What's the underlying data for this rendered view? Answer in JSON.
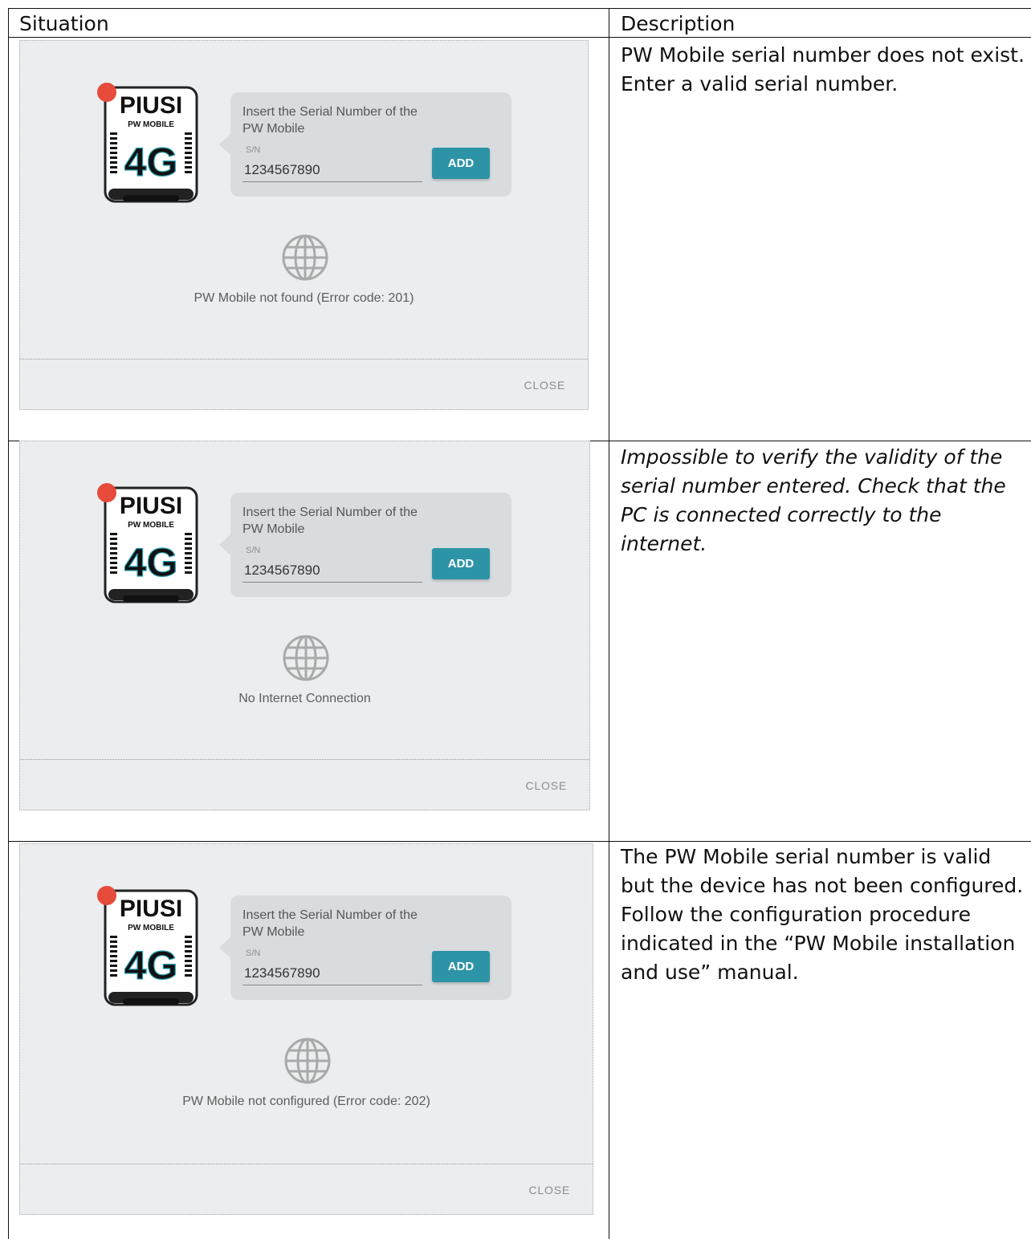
{
  "table": {
    "header_situation": "Situation",
    "header_description": "Description"
  },
  "rows": [
    {
      "dialog": {
        "prompt": "Insert the Serial Number of the PW Mobile",
        "sn_label": "S/N",
        "sn_value": "1234567890",
        "add_label": "ADD",
        "status": "PW Mobile not found (Error code: 201)",
        "close_label": "CLOSE"
      },
      "description": "PW Mobile serial number does not exist. Enter a valid serial number."
    },
    {
      "dialog": {
        "prompt": "Insert the Serial Number of the PW Mobile",
        "sn_label": "S/N",
        "sn_value": "1234567890",
        "add_label": "ADD",
        "status": "No Internet Connection",
        "close_label": "CLOSE"
      },
      "description": "Impossible to verify the validity of the serial number entered. Check that the PC is connected correctly to the internet."
    },
    {
      "dialog": {
        "prompt": "Insert the Serial Number of the PW Mobile",
        "sn_label": "S/N",
        "sn_value": "1234567890",
        "add_label": "ADD",
        "status": "PW Mobile not configured (Error code: 202)",
        "close_label": "CLOSE"
      },
      "description": "The PW Mobile serial number is valid but the device has not been configured. Follow the configuration procedure indicated in the “PW Mobile installation and use” manual."
    }
  ],
  "device_logo": {
    "brand": "PIUSI",
    "model": "PW MOBILE",
    "network": "4G"
  },
  "colors": {
    "dialog_bg": "#ebedee",
    "bubble_bg": "#d8dcde",
    "add_button": "#2d93a6",
    "status_dot": "#e64b3c",
    "logo_red": "#d62b2b",
    "logo_teal": "#2aa0b4"
  },
  "icons": [
    "globe-icon",
    "device-icon",
    "status-dot-icon"
  ]
}
